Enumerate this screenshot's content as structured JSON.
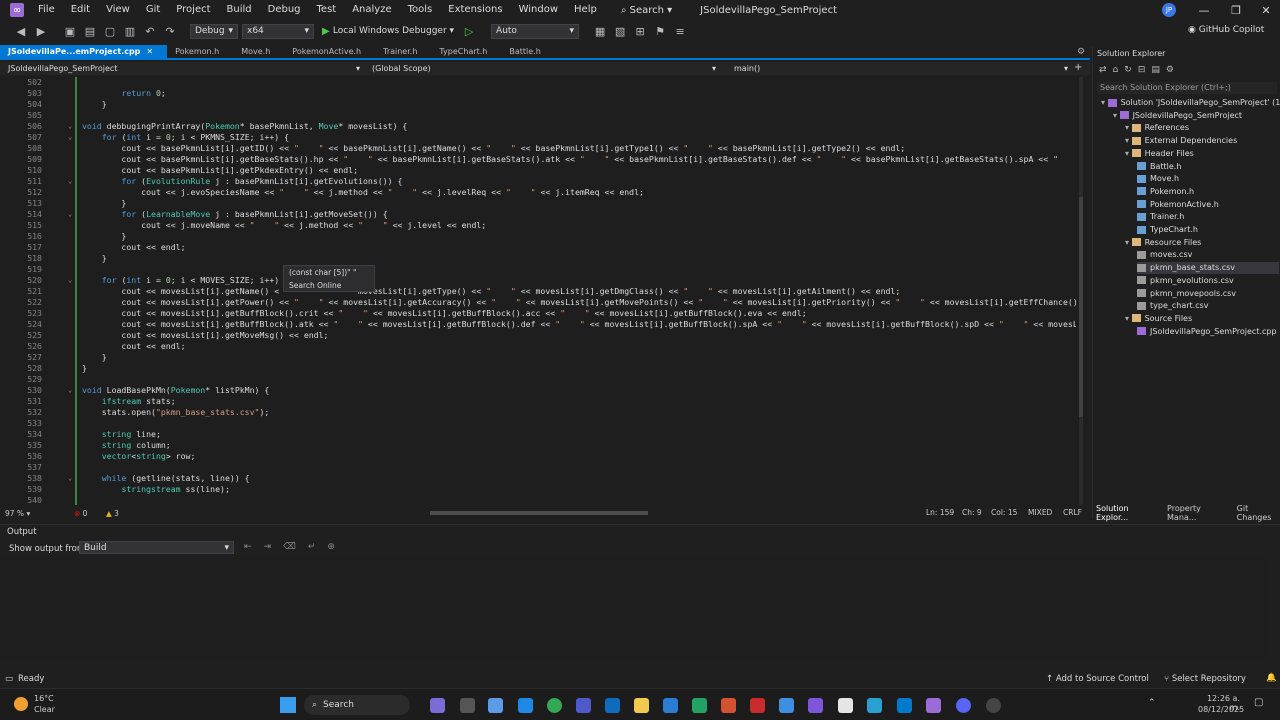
{
  "menubar": {
    "items": [
      "File",
      "Edit",
      "View",
      "Git",
      "Project",
      "Build",
      "Debug",
      "Test",
      "Analyze",
      "Tools",
      "Extensions",
      "Window",
      "Help"
    ],
    "search_label": "Search",
    "solution_title": "JSoldevillaPego_SemProject",
    "avatar_initials": "JP"
  },
  "toolbar": {
    "config": "Debug",
    "platform": "x64",
    "run_label": "Local Windows Debugger",
    "debug_target": "Auto",
    "copilot_label": "GitHub Copilot"
  },
  "tabs": [
    "JSoldevillaPe...emProject.cpp",
    "Pokemon.h",
    "Move.h",
    "PokemonActive.h",
    "Trainer.h",
    "TypeChart.h",
    "Battle.h"
  ],
  "navbar": {
    "project": "JSoldevillaPego_SemProject",
    "scope": "(Global Scope)",
    "member": "main()"
  },
  "code": [
    {
      "n": "502",
      "t": ""
    },
    {
      "n": "503",
      "t": "        return 0;"
    },
    {
      "n": "504",
      "t": "    }"
    },
    {
      "n": "505",
      "t": ""
    },
    {
      "n": "506",
      "t": "void debbugingPrintArray(Pokemon* basePkmnList, Move* movesList) {"
    },
    {
      "n": "507",
      "t": "    for (int i = 0; i < PKMNS_SIZE; i++) {"
    },
    {
      "n": "508",
      "t": "        cout << basePkmnList[i].getID() << \"    \" << basePkmnList[i].getName() << \"    \" << basePkmnList[i].getType1() << \"    \" << basePkmnList[i].getType2() << endl;"
    },
    {
      "n": "509",
      "t": "        cout << basePkmnList[i].getBaseStats().hp << \"    \" << basePkmnList[i].getBaseStats().atk << \"    \" << basePkmnList[i].getBaseStats().def << \"    \" << basePkmnList[i].getBaseStats().spA << \""
    },
    {
      "n": "510",
      "t": "        cout << basePkmnList[i].getPkdexEntry() << endl;"
    },
    {
      "n": "511",
      "t": "        for (EvolutionRule j : basePkmnList[i].getEvolutions()) {"
    },
    {
      "n": "512",
      "t": "            cout << j.evoSpeciesName << \"    \" << j.method << \"    \" << j.levelReq << \"    \" << j.itemReq << endl;"
    },
    {
      "n": "513",
      "t": "        }"
    },
    {
      "n": "514",
      "t": "        for (LearnableMove j : basePkmnList[i].getMoveSet()) {"
    },
    {
      "n": "515",
      "t": "            cout << j.moveName << \"    \" << j.method << \"    \" << j.level << endl;"
    },
    {
      "n": "516",
      "t": "        }"
    },
    {
      "n": "517",
      "t": "        cout << endl;"
    },
    {
      "n": "518",
      "t": "    }"
    },
    {
      "n": "519",
      "t": ""
    },
    {
      "n": "520",
      "t": "    for (int i = 0; i < MOVES_SIZE; i++)"
    },
    {
      "n": "521",
      "t": "        cout << movesList[i].getName() <                movesList[i].getType() << \"    \" << movesList[i].getDmgClass() << \"    \" << movesList[i].getAilment() << endl;"
    },
    {
      "n": "522",
      "t": "        cout << movesList[i].getPower() << \"    \" << movesList[i].getAccuracy() << \"    \" << movesList[i].getMovePoints() << \"    \" << movesList[i].getPriority() << \"    \" << movesList[i].getEffChance()"
    },
    {
      "n": "523",
      "t": "        cout << movesList[i].getBuffBlock().crit << \"    \" << movesList[i].getBuffBlock().acc << \"    \" << movesList[i].getBuffBlock().eva << endl;"
    },
    {
      "n": "524",
      "t": "        cout << movesList[i].getBuffBlock().atk << \"    \" << movesList[i].getBuffBlock().def << \"    \" << movesList[i].getBuffBlock().spA << \"    \" << movesList[i].getBuffBlock().spD << \"    \" << movesL"
    },
    {
      "n": "525",
      "t": "        cout << movesList[i].getMoveMsg() << endl;"
    },
    {
      "n": "526",
      "t": "        cout << endl;"
    },
    {
      "n": "527",
      "t": "    }"
    },
    {
      "n": "528",
      "t": "}"
    },
    {
      "n": "529",
      "t": ""
    },
    {
      "n": "530",
      "t": "void LoadBasePkMn(Pokemon* listPkMn) {"
    },
    {
      "n": "531",
      "t": "    ifstream stats;"
    },
    {
      "n": "532",
      "t": "    stats.open(\"pkmn_base_stats.csv\");"
    },
    {
      "n": "533",
      "t": ""
    },
    {
      "n": "534",
      "t": "    string line;"
    },
    {
      "n": "535",
      "t": "    string column;"
    },
    {
      "n": "536",
      "t": "    vector<string> row;"
    },
    {
      "n": "537",
      "t": ""
    },
    {
      "n": "538",
      "t": "    while (getline(stats, line)) {"
    },
    {
      "n": "539",
      "t": "        stringstream ss(line);"
    },
    {
      "n": "540",
      "t": ""
    }
  ],
  "tooltip": {
    "type": "(const char [5])\"    \"",
    "search": "Search Online"
  },
  "editor_status": {
    "zoom": "97 %",
    "errors": "0",
    "warnings": "3",
    "line": "Ln: 159",
    "char": "Ch: 9",
    "col": "Col: 15",
    "encoding": "MIXED",
    "eol": "CRLF"
  },
  "solution_explorer": {
    "title": "Solution Explorer",
    "search_placeholder": "Search Solution Explorer (Ctrl+;)",
    "items": [
      {
        "label": "Solution 'JSoldevillaPego_SemProject' (1 of 1",
        "indent": 0,
        "icon": "sol"
      },
      {
        "label": "JSoldevillaPego_SemProject",
        "indent": 1,
        "icon": "proj"
      },
      {
        "label": "References",
        "indent": 2,
        "icon": "folder"
      },
      {
        "label": "External Dependencies",
        "indent": 2,
        "icon": "folder"
      },
      {
        "label": "Header Files",
        "indent": 2,
        "icon": "folder"
      },
      {
        "label": "Battle.h",
        "indent": 3,
        "icon": "h"
      },
      {
        "label": "Move.h",
        "indent": 3,
        "icon": "h"
      },
      {
        "label": "Pokemon.h",
        "indent": 3,
        "icon": "h"
      },
      {
        "label": "PokemonActive.h",
        "indent": 3,
        "icon": "h"
      },
      {
        "label": "Trainer.h",
        "indent": 3,
        "icon": "h"
      },
      {
        "label": "TypeChart.h",
        "indent": 3,
        "icon": "h"
      },
      {
        "label": "Resource Files",
        "indent": 2,
        "icon": "folder"
      },
      {
        "label": "moves.csv",
        "indent": 3,
        "icon": "file"
      },
      {
        "label": "pkmn_base_stats.csv",
        "indent": 3,
        "icon": "file"
      },
      {
        "label": "pkmn_evolutions.csv",
        "indent": 3,
        "icon": "file"
      },
      {
        "label": "pkmn_movepools.csv",
        "indent": 3,
        "icon": "file"
      },
      {
        "label": "type_chart.csv",
        "indent": 3,
        "icon": "file"
      },
      {
        "label": "Source Files",
        "indent": 2,
        "icon": "folder"
      },
      {
        "label": "JSoldevillaPego_SemProject.cpp",
        "indent": 3,
        "icon": "cpp"
      }
    ],
    "selected_index": 13,
    "bottom_tabs": [
      "Solution Explor...",
      "Property Mana...",
      "Git Changes"
    ]
  },
  "output": {
    "title": "Output",
    "show_from_label": "Show output from:",
    "source": "Build"
  },
  "statusbar": {
    "ready": "Ready",
    "add_source_control": "Add to Source Control",
    "select_repository": "Select Repository"
  },
  "taskbar": {
    "weather_temp": "16°C",
    "weather_desc": "Clear",
    "search": "Search",
    "time": "12:26 a. m.",
    "date": "08/12/2025"
  }
}
